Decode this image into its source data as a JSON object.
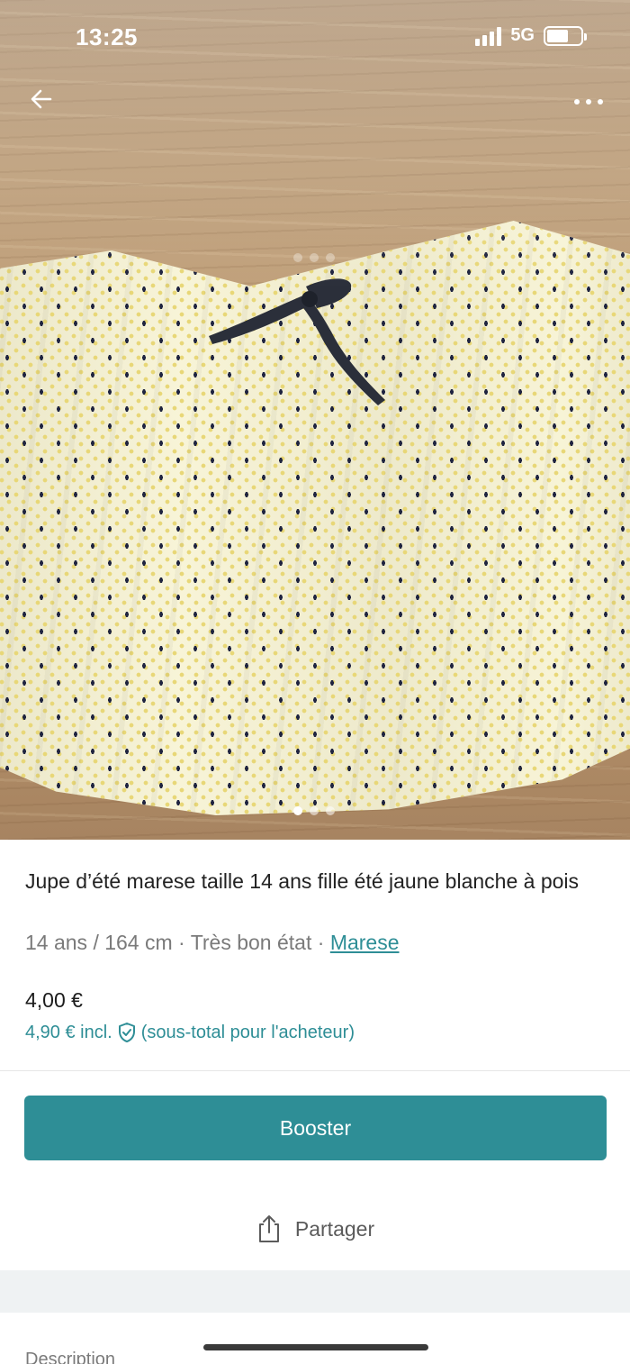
{
  "status_bar": {
    "time": "13:25",
    "network": "5G",
    "battery_level": 0.65
  },
  "photo": {
    "back_icon": "arrow-left-icon",
    "more_icon": "more-horizontal-icon",
    "carousel": {
      "count": 3,
      "active_index": 0
    }
  },
  "item": {
    "title": "Jupe d’été marese taille 14 ans fille été jaune blanche à pois",
    "size": "14 ans / 164 cm",
    "separator": " · ",
    "condition": "Très bon état",
    "brand": "Marese",
    "price": "4,00 €",
    "price_incl": "4,90 € incl.",
    "price_incl_note": "(sous-total pour l'acheteur)",
    "protection_icon": "shield-check-icon"
  },
  "actions": {
    "booster_label": "Booster",
    "share_label": "Partager",
    "share_icon": "share-icon"
  },
  "section": {
    "description_label": "Description"
  },
  "colors": {
    "accent": "#2e8e96",
    "text": "#222222",
    "muted": "#7a7a7a"
  }
}
